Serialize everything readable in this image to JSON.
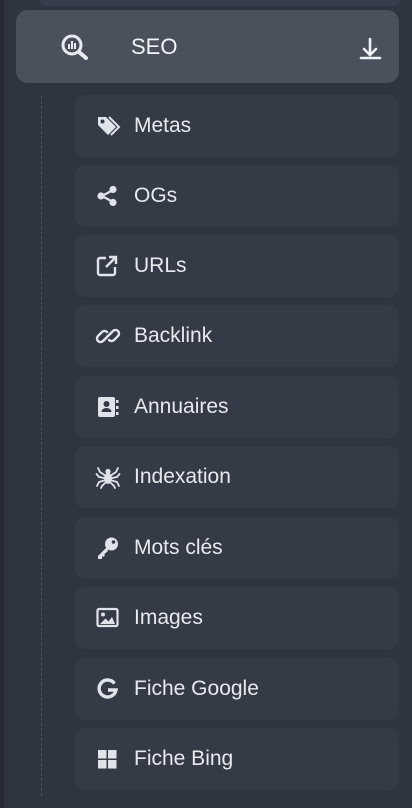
{
  "menu": {
    "section": {
      "label": "SEO",
      "icon": "search-chart-icon",
      "toggle_icon": "arrow-down-icon",
      "expanded": true
    },
    "items": [
      {
        "label": "Metas",
        "icon": "tags-icon"
      },
      {
        "label": "OGs",
        "icon": "share-icon"
      },
      {
        "label": "URLs",
        "icon": "external-link-icon"
      },
      {
        "label": "Backlink",
        "icon": "link-icon"
      },
      {
        "label": "Annuaires",
        "icon": "address-book-icon"
      },
      {
        "label": "Indexation",
        "icon": "spider-icon"
      },
      {
        "label": "Mots clés",
        "icon": "key-icon"
      },
      {
        "label": "Images",
        "icon": "image-icon"
      },
      {
        "label": "Fiche Google",
        "icon": "google-icon"
      },
      {
        "label": "Fiche Bing",
        "icon": "windows-icon"
      }
    ]
  },
  "colors": {
    "background": "#2f3540",
    "header_bg": "#4a515d",
    "item_bg": "#353b46",
    "icon": "#dfe3ea",
    "text": "#e6e9ee"
  }
}
